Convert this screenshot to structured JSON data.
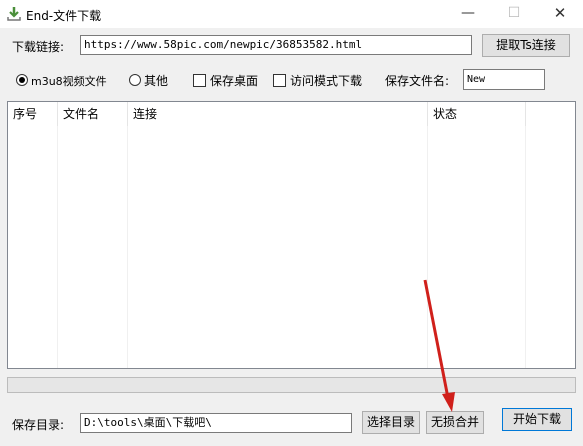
{
  "window": {
    "title": "End-文件下载",
    "minimize": "—",
    "maximize": "☐",
    "close": "✕"
  },
  "download": {
    "label": "下载链接:",
    "url": "https://www.58pic.com/newpic/36853582.html",
    "extract_button": "提取Ts连接"
  },
  "options": {
    "m3u8_label": "m3u8视频文件",
    "m3u8_selected": true,
    "other_label": "其他",
    "other_selected": false,
    "save_desktop_label": "保存桌面",
    "save_desktop_checked": false,
    "visit_mode_label": "访问模式下载",
    "visit_mode_checked": false,
    "filename_label": "保存文件名:",
    "filename_value": "New"
  },
  "table": {
    "columns": [
      "序号",
      "文件名",
      "连接",
      "状态"
    ],
    "rows": []
  },
  "progress": {
    "fraction": 0
  },
  "footer": {
    "dir_label": "保存目录:",
    "dir_value": "D:\\tools\\桌面\\下载吧\\",
    "choose_dir_button": "选择目录",
    "merge_button": "无损合并",
    "start_button": "开始下载"
  },
  "colors": {
    "annotation_arrow": "#d0201b"
  },
  "icons": {
    "app": "download-arrow-icon"
  }
}
